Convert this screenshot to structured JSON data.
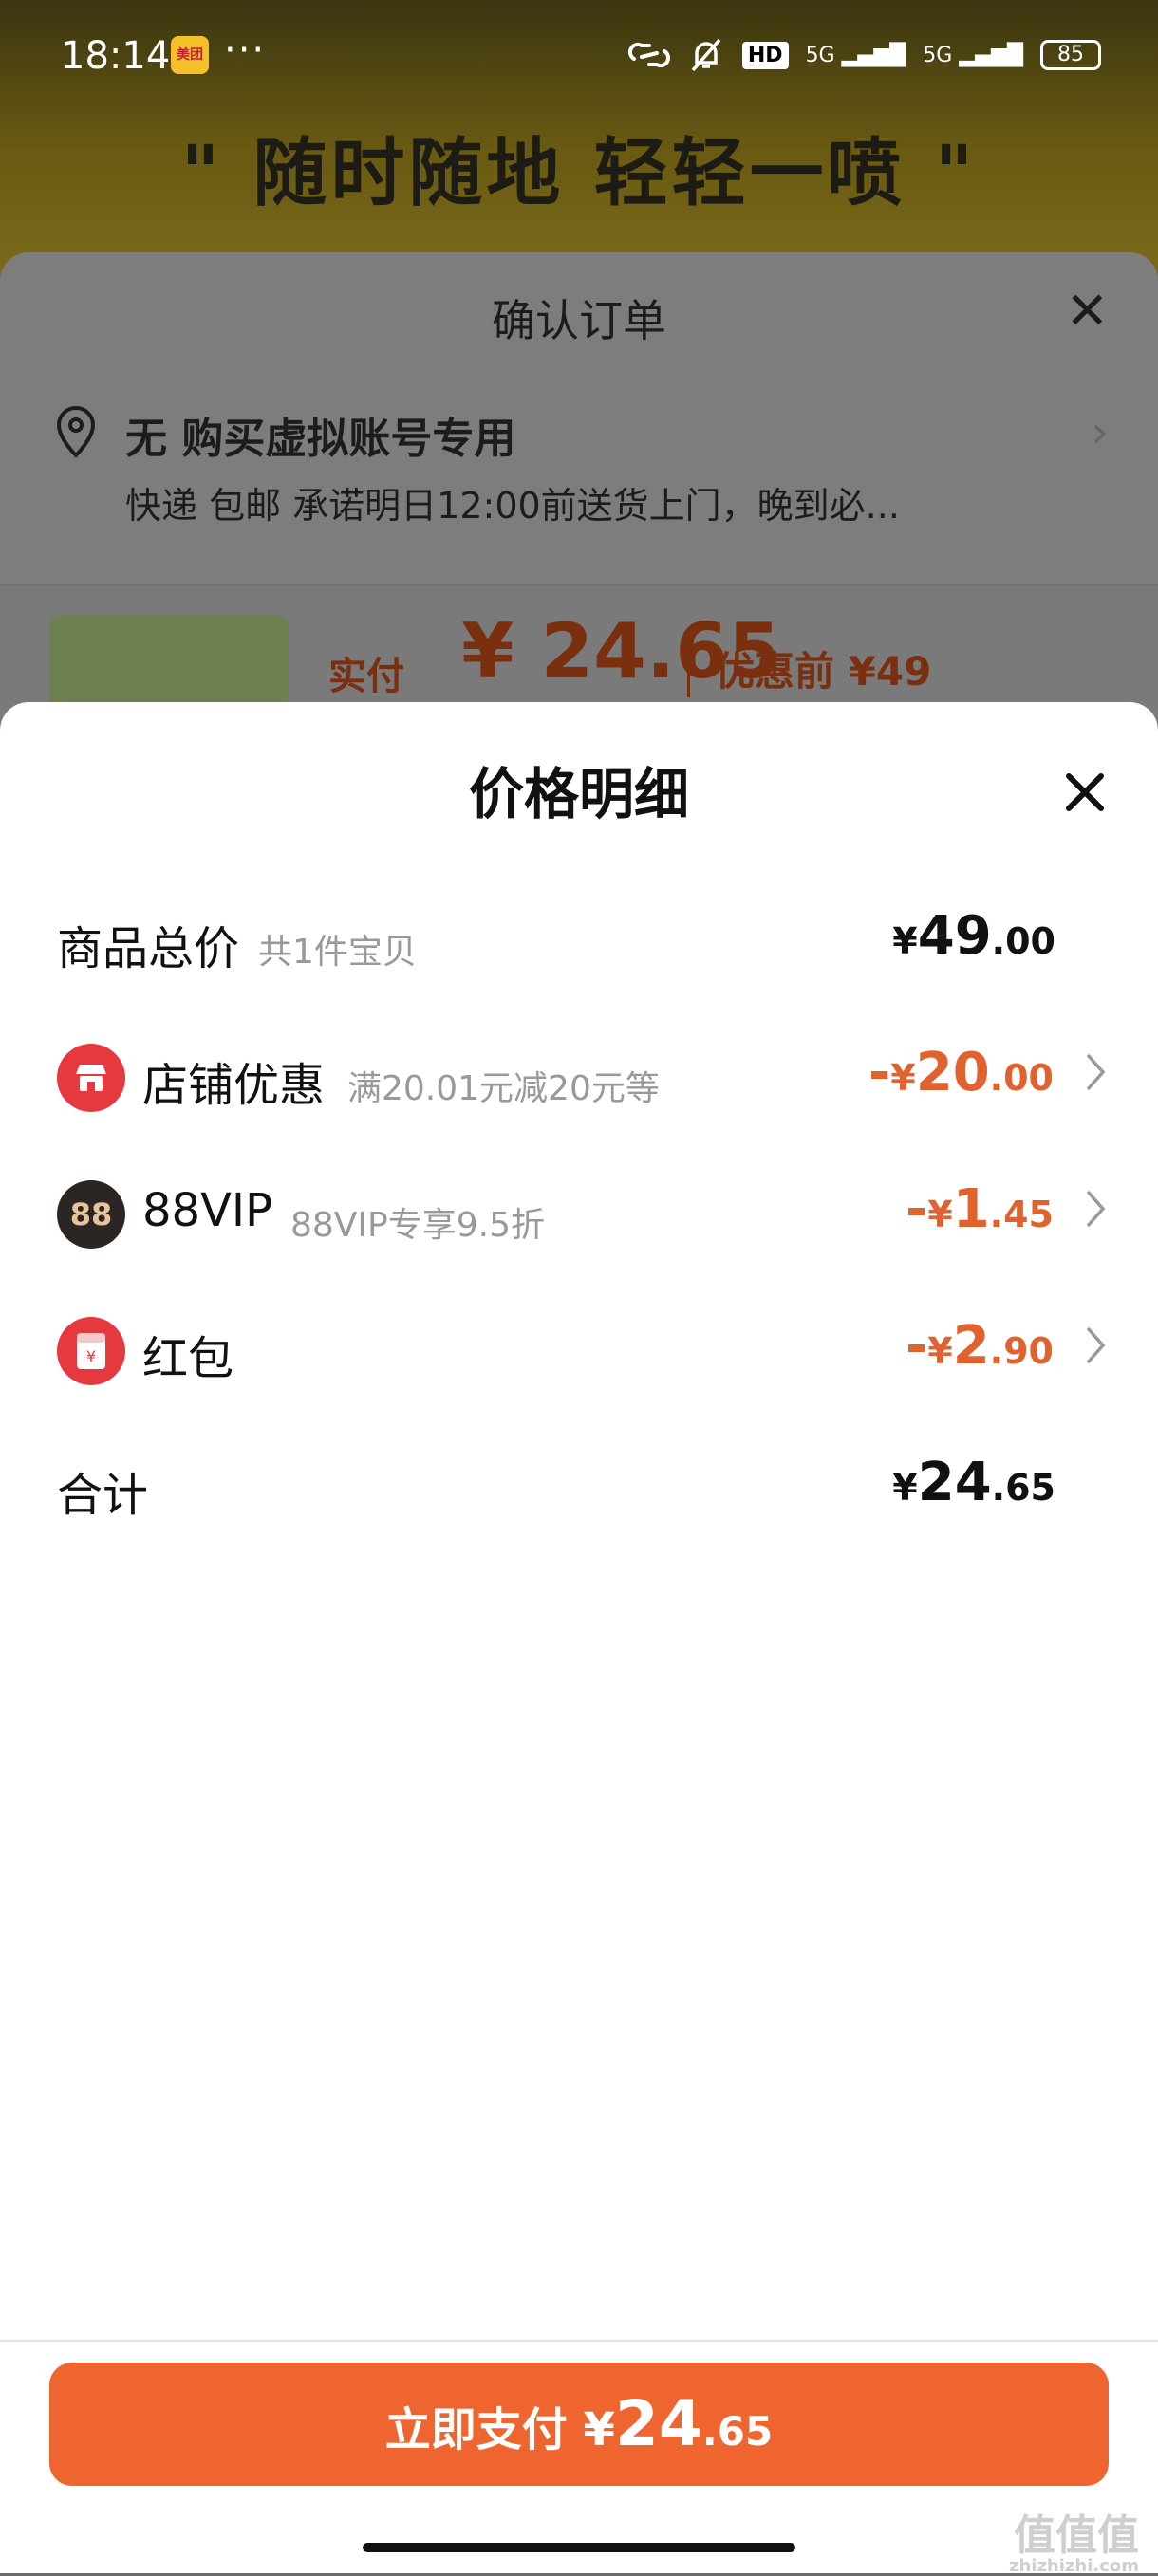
{
  "status_bar": {
    "time": "18:14",
    "app_badge": "美团",
    "more": "···",
    "hd": "HD",
    "signal1": "5G",
    "signal2": "5G",
    "battery": "85"
  },
  "background": {
    "slogan": "\" 随时随地 轻轻一喷 \"",
    "order_title": "确认订单",
    "address_name": "无 购买虚拟账号专用",
    "address_desc": "快递 包邮 承诺明日12:00前送货上门，晚到必...",
    "paid_label": "实付",
    "paid_amount": "¥ 24.65",
    "before_label": "优惠前 ¥49"
  },
  "detail": {
    "title": "价格明细",
    "rows": [
      {
        "label": "商品总价",
        "sub": "共1件宝贝",
        "cur": "¥",
        "int": "49",
        "dec": ".00",
        "sign": ""
      },
      {
        "label": "店铺优惠",
        "sub": "满20.01元减20元等",
        "cur": "¥",
        "int": "20",
        "dec": ".00",
        "sign": "-"
      },
      {
        "label": "88VIP",
        "sub": "88VIP专享9.5折",
        "cur": "¥",
        "int": "1",
        "dec": ".45",
        "sign": "-",
        "icon_text": "88"
      },
      {
        "label": "红包",
        "sub": "",
        "cur": "¥",
        "int": "2",
        "dec": ".90",
        "sign": "-",
        "icon_text": "¥"
      },
      {
        "label": "合计",
        "sub": "",
        "cur": "¥",
        "int": "24",
        "dec": ".65",
        "sign": ""
      }
    ]
  },
  "pay_button": {
    "prefix": "立即支付 ¥",
    "int": "24",
    "dec": ".65"
  },
  "watermark": {
    "mark": "值值值",
    "url": "zhizhizhi.com"
  },
  "colors": {
    "accent": "#ee6530",
    "discount": "#e0622f",
    "store_icon": "#e5393f",
    "vip_icon": "#2b2523",
    "redpacket_icon": "#e5393f"
  }
}
